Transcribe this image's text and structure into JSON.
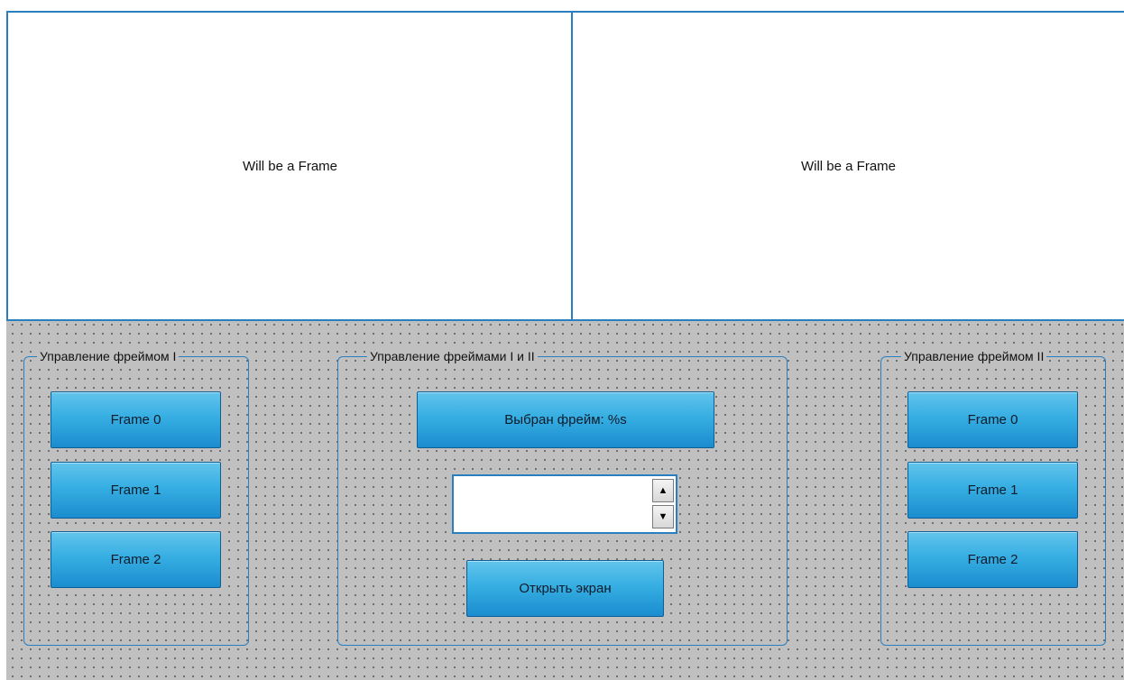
{
  "frames": [
    {
      "placeholder": "Will be a Frame"
    },
    {
      "placeholder": "Will be a Frame"
    }
  ],
  "groups": {
    "left": {
      "title": "Управление фреймом I",
      "buttons": [
        "Frame 0",
        "Frame 1",
        "Frame 2"
      ]
    },
    "center": {
      "title": "Управление фреймами I и II",
      "selected_label": "Выбран фрейм: %s",
      "spin_value": "",
      "spin_up_icon": "triangle-up",
      "spin_down_icon": "triangle-down",
      "open_label": "Открыть экран"
    },
    "right": {
      "title": "Управление фреймом II",
      "buttons": [
        "Frame 0",
        "Frame 1",
        "Frame 2"
      ]
    }
  },
  "colors": {
    "canvas": "#c0c0c0",
    "accent": "#2a7fc0",
    "button": "#36aee2"
  }
}
